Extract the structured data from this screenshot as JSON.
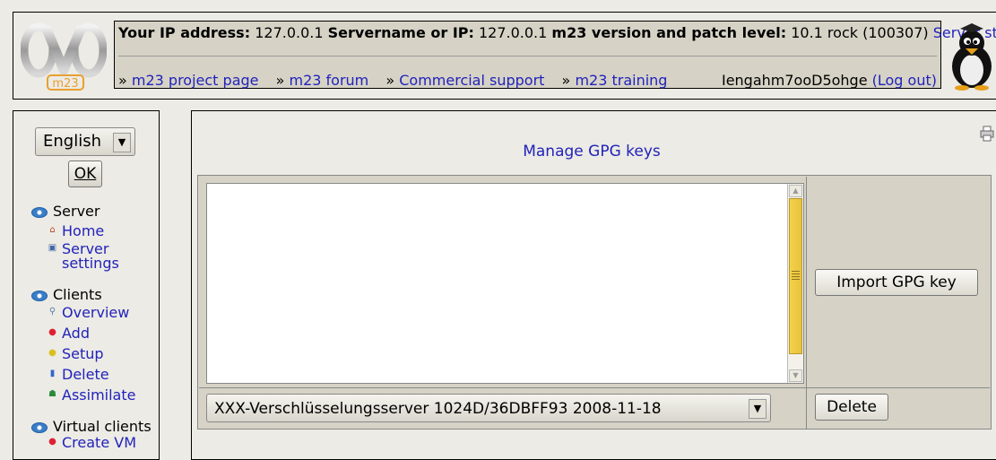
{
  "header": {
    "info": {
      "ip_label": "Your IP address:",
      "ip_value": "127.0.0.1",
      "server_label": "Servername or IP:",
      "server_value": "127.0.0.1",
      "version_label": "m23 version and patch level:",
      "version_value": "10.1 rock (100307)",
      "server_status": "Server status"
    },
    "links": [
      {
        "prefix": "»",
        "label": "m23 project page"
      },
      {
        "prefix": "»",
        "label": "m23 forum"
      },
      {
        "prefix": "»",
        "label": "Commercial support"
      },
      {
        "prefix": "»",
        "label": "m23 training"
      }
    ],
    "user": "Iengahm7ooD5ohge",
    "logout": "(Log out)",
    "logo_text": "m23"
  },
  "sidebar": {
    "language_value": "English",
    "ok_label": "OK",
    "groups": [
      {
        "title": "Server",
        "items": [
          {
            "label": "Home",
            "icon": "house-icon"
          },
          {
            "label": "Server settings",
            "icon": "settings-icon"
          }
        ]
      },
      {
        "title": "Clients",
        "items": [
          {
            "label": "Overview",
            "icon": "magnifier-icon"
          },
          {
            "label": "Add",
            "icon": "red-drum-icon"
          },
          {
            "label": "Setup",
            "icon": "yellow-drum-icon"
          },
          {
            "label": "Delete",
            "icon": "trash-icon"
          },
          {
            "label": "Assimilate",
            "icon": "alien-icon"
          }
        ]
      },
      {
        "title": "Virtual clients",
        "items": [
          {
            "label": "Create VM",
            "icon": "red-drum-icon"
          }
        ]
      }
    ]
  },
  "main": {
    "title": "Manage GPG keys",
    "textarea_value": "",
    "import_label": "Import GPG key",
    "key_select_value": "XXX-Verschlüsselungsserver 1024D/36DBFF93 2008-11-18",
    "delete_label": "Delete"
  },
  "colors": {
    "link": "#2222bb",
    "panel": "#d6d3c6",
    "background": "#ecebe5",
    "scroll_thumb": "#f3d24a"
  }
}
